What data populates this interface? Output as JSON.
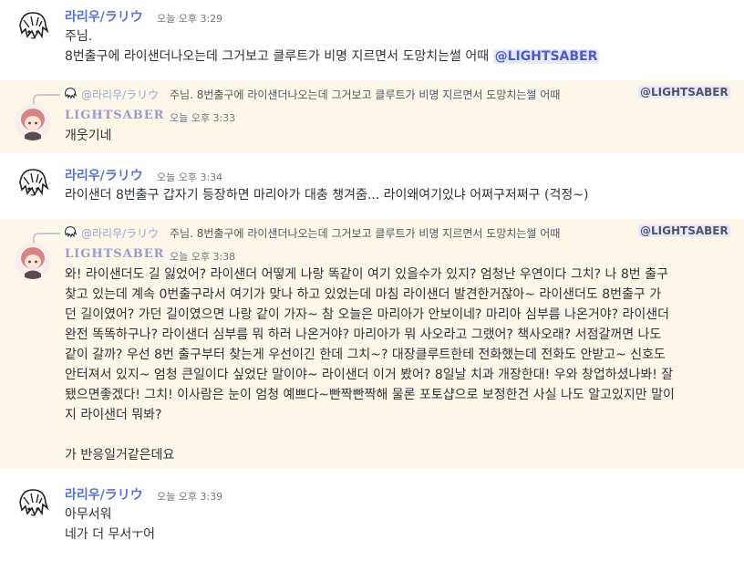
{
  "messages": [
    {
      "author": "라리우/ラリウ",
      "time": "오늘 오후 3:29",
      "line1": "주님.",
      "line2_text": "8번출구에 라이샌더나오는데 그거보고 클루트가 비명 지르면서 도망치는썰 어때",
      "mention": "@LIGHTSABER"
    },
    {
      "reply_author": "@라리우/ラリウ",
      "reply_text": "주님. 8번출구에 라이샌더나오는데 그거보고 클루트가 비명 지르면서 도망치는썰 어때",
      "reply_mention": "@LIGHTSABER",
      "author": "LIGHTSABER",
      "time": "오늘 오후 3:33",
      "line1": "개웃기네"
    },
    {
      "author": "라리우/ラリウ",
      "time": "오늘 오후 3:34",
      "line1": "라이샌더 8번출구 갑자기 등장하면 마리아가 대충 챙겨줌... 라이왜여기있냐 어쩌구저쩌구 (걱정~)"
    },
    {
      "reply_author": "@라리우/ラリウ",
      "reply_text": "주님. 8번출구에 라이샌더나오는데 그거보고 클루트가 비명 지르면서 도망치는썰 어때",
      "reply_mention": "@LIGHTSABER",
      "author": "LIGHTSABER",
      "time": "오늘 오후 3:38",
      "lines": [
        "와! 라이샌더도 길 잃었어? 라이샌더 어떻게 나랑 똑같이 여기 있을수가 있지? 엄청난 우연이다 그치? 나 8번 출구",
        "찾고 있는데 계속 0번출구라서 여기가 맞나 하고 있었는데 마침 라이샌더 발견한거잖아~ 라이샌더도 8번출구 가",
        "던 길이였어? 가던 길이였으면 나랑 같이 가자~ 참 오늘은 마리아가 안보이네? 마리아 심부름 나온거야? 라이샌더",
        "완전 똑똑하구나? 라이샌더 심부름 뭐 하러 나온거야? 마리아가 뭐 사오라고 그랬어? 책사오래? 서점갈꺼면 나도",
        "같이 갈까? 우선 8번 출구부터 찾는게 우선이긴 한데 그치~? 대장클루트한테 전화했는데 전화도 안받고~ 신호도",
        "안터져서 있지~ 엄청 큰일이다 싶었단 말이야~ 라이샌더 이거 봤어? 8일날 치과 개장한대! 우와 창업하셨나봐! 잘",
        "됐으면좋겠다! 그치! 이사람은 눈이 엄청 예쁘다~빤짝빤짝해 물론 포토샵으로 보정한건 사실 나도 알고있지만 말이",
        "지 라이샌더 뭐봐?",
        "",
        "가 반응일거같은데요"
      ]
    },
    {
      "author": "라리우/ラリウ",
      "time": "오늘 오후 3:39",
      "line1": "아무서워",
      "line2": "네가 더 무서ㅜ어"
    }
  ],
  "icons": {
    "riu_avatar": "sketch-face-avatar",
    "ls_avatar": "pink-hair-chibi-avatar"
  },
  "colors": {
    "highlight_bg": "#fdf7e9",
    "highlight_bar": "#e8c77a",
    "mention_bg": "#e6e8fd",
    "mention_fg": "#4a5bd0",
    "riu_name": "#5a74c8",
    "ls_name": "#9b9ad8"
  }
}
